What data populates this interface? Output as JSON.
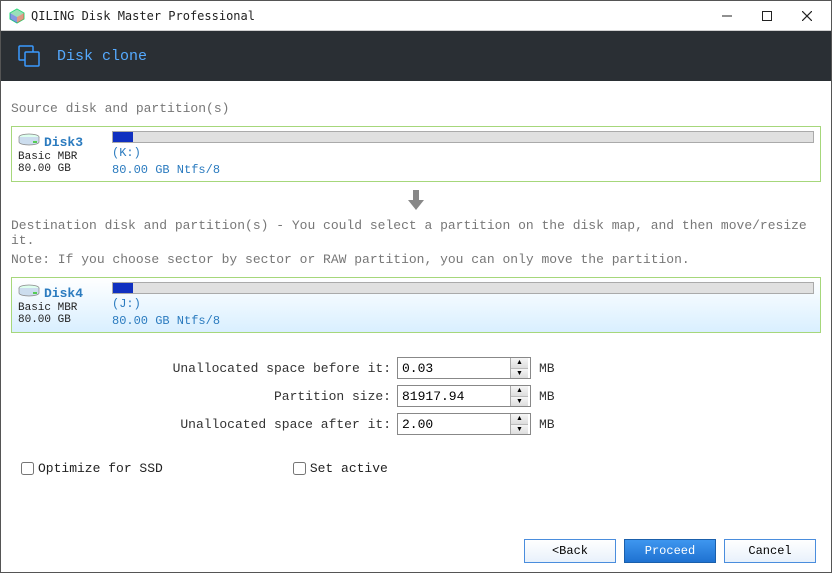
{
  "window": {
    "title": "QILING Disk Master Professional"
  },
  "header": {
    "title": "Disk clone"
  },
  "source": {
    "section_label": "Source disk and partition(s)",
    "disk_name": "Disk3",
    "disk_type": "Basic MBR",
    "disk_size": "80.00 GB",
    "part_letter": "(K:)",
    "part_desc": "80.00 GB Ntfs/8"
  },
  "dest": {
    "section_label": "Destination disk and partition(s) - You could select a partition on the disk map, and then move/resize it.",
    "note": "Note: If you choose sector by sector or RAW partition, you can only move the partition.",
    "disk_name": "Disk4",
    "disk_type": "Basic MBR",
    "disk_size": "80.00 GB",
    "part_letter": "(J:)",
    "part_desc": "80.00 GB Ntfs/8"
  },
  "fields": {
    "before_label": "Unallocated space before it:",
    "before_value": "0.03",
    "size_label": "Partition size:",
    "size_value": "81917.94",
    "after_label": "Unallocated space after it:",
    "after_value": "2.00",
    "unit": "MB"
  },
  "options": {
    "optimize_ssd": "Optimize for SSD",
    "set_active": "Set active"
  },
  "buttons": {
    "back": "<Back",
    "proceed": "Proceed",
    "cancel": "Cancel"
  }
}
